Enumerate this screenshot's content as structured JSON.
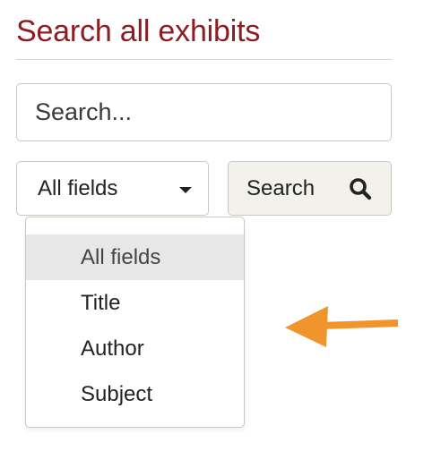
{
  "heading": "Search all exhibits",
  "search": {
    "placeholder": "Search..."
  },
  "field_select": {
    "selected": "All fields"
  },
  "search_button": {
    "label": "Search",
    "icon": "search-icon"
  },
  "dropdown": {
    "options": [
      {
        "label": "All fields",
        "active": true
      },
      {
        "label": "Title",
        "active": false
      },
      {
        "label": "Author",
        "active": false
      },
      {
        "label": "Subject",
        "active": false
      }
    ]
  },
  "annotation": {
    "icon": "left-arrow-icon",
    "color": "#f0952b"
  },
  "colors": {
    "heading": "#8c1d22",
    "button_bg": "#f2f1ec",
    "active_option_bg": "#e7e7e7"
  }
}
